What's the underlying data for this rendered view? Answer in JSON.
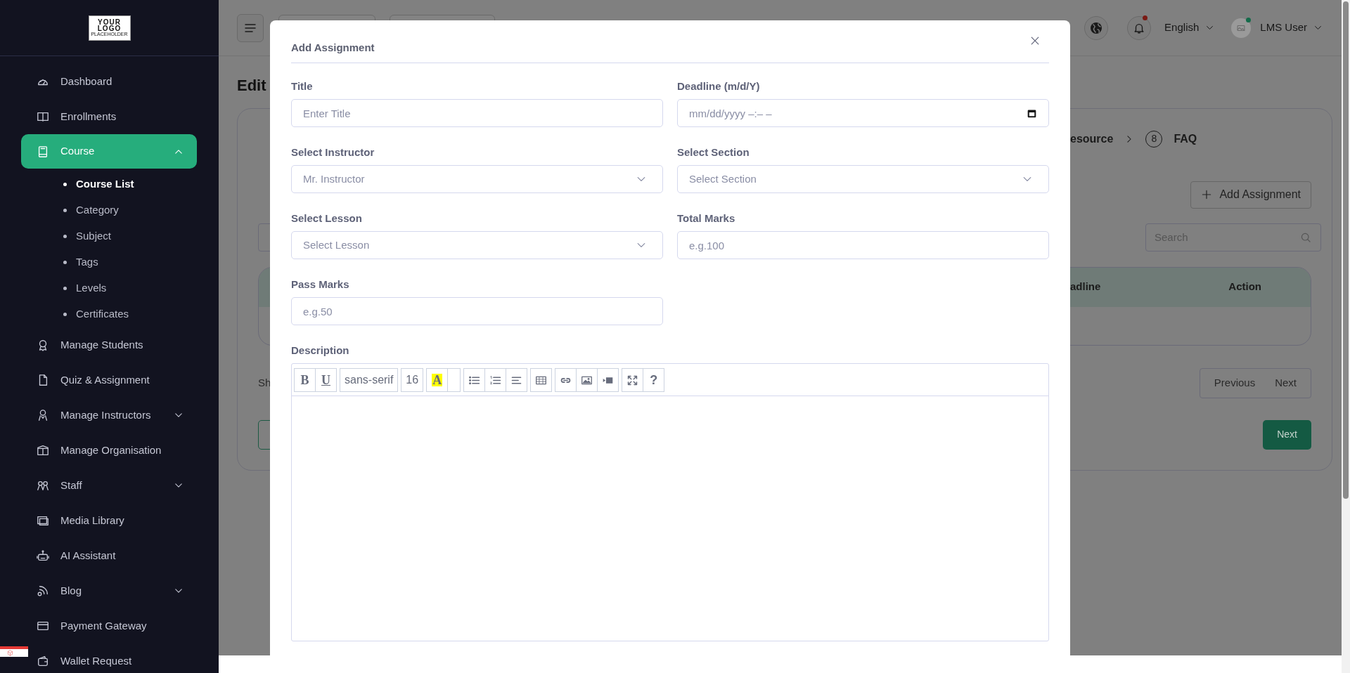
{
  "sidebar": {
    "logo": {
      "line1": "YOUR",
      "line2": "LOGO",
      "tagline": "PLACEHOLDER"
    },
    "items": [
      {
        "label": "Dashboard",
        "selected": false
      },
      {
        "label": "Enrollments",
        "selected": false
      },
      {
        "label": "Course",
        "selected": true,
        "expanded": true,
        "children": [
          {
            "label": "Course List",
            "selected": true
          },
          {
            "label": "Category",
            "selected": false
          },
          {
            "label": "Subject",
            "selected": false
          },
          {
            "label": "Tags",
            "selected": false
          },
          {
            "label": "Levels",
            "selected": false
          },
          {
            "label": "Certificates",
            "selected": false
          }
        ]
      },
      {
        "label": "Manage Students",
        "selected": false
      },
      {
        "label": "Quiz & Assignment",
        "selected": false
      },
      {
        "label": "Manage Instructors",
        "selected": false,
        "expanded": false
      },
      {
        "label": "Manage Organisation",
        "selected": false
      },
      {
        "label": "Staff",
        "selected": false,
        "expanded": false
      },
      {
        "label": "Media Library",
        "selected": false
      },
      {
        "label": "AI Assistant",
        "selected": false
      },
      {
        "label": "Blog",
        "selected": false,
        "expanded": false
      },
      {
        "label": "Payment Gateway",
        "selected": false
      },
      {
        "label": "Wallet Request",
        "selected": false
      }
    ]
  },
  "topbar": {
    "language": "English",
    "user": "LMS User",
    "notification_unread": true,
    "user_online": true
  },
  "page": {
    "title": "Edit",
    "steps": [
      {
        "label": "esource"
      },
      {
        "number": "8",
        "label": "FAQ"
      }
    ],
    "add_button": "Add Assignment",
    "search": {
      "placeholder": "Search"
    },
    "table": {
      "columns": [
        "adline",
        "Action"
      ]
    },
    "info_text": "Sh",
    "pagination": [
      "Previous",
      "Next"
    ],
    "next_button": "Next"
  },
  "modal": {
    "title": "Add Assignment",
    "fields": [
      {
        "kind": "text",
        "label": "Title",
        "placeholder": "Enter Title"
      },
      {
        "kind": "datetime",
        "label": "Deadline (m/d/Y)",
        "placeholder": "mm/dd/yyyy –:– –"
      },
      {
        "kind": "select",
        "label": "Select Instructor",
        "value": "Mr. Instructor"
      },
      {
        "kind": "select",
        "label": "Select Section",
        "value": "Select Section"
      },
      {
        "kind": "select",
        "label": "Select Lesson",
        "value": "Select Lesson"
      },
      {
        "kind": "text",
        "label": "Total Marks",
        "placeholder": "e.g.100"
      },
      {
        "kind": "text",
        "label": "Pass Marks",
        "placeholder": "e.g.50"
      }
    ],
    "description": {
      "label": "Description",
      "toolbar": [
        {
          "kind": "bold",
          "label": "B"
        },
        {
          "kind": "underline",
          "label": "U"
        },
        {
          "kind": "font",
          "label": "sans-serif"
        },
        {
          "kind": "size",
          "label": "16"
        },
        {
          "kind": "highlight",
          "label": "A"
        },
        {
          "kind": "help",
          "label": "?"
        }
      ]
    }
  }
}
